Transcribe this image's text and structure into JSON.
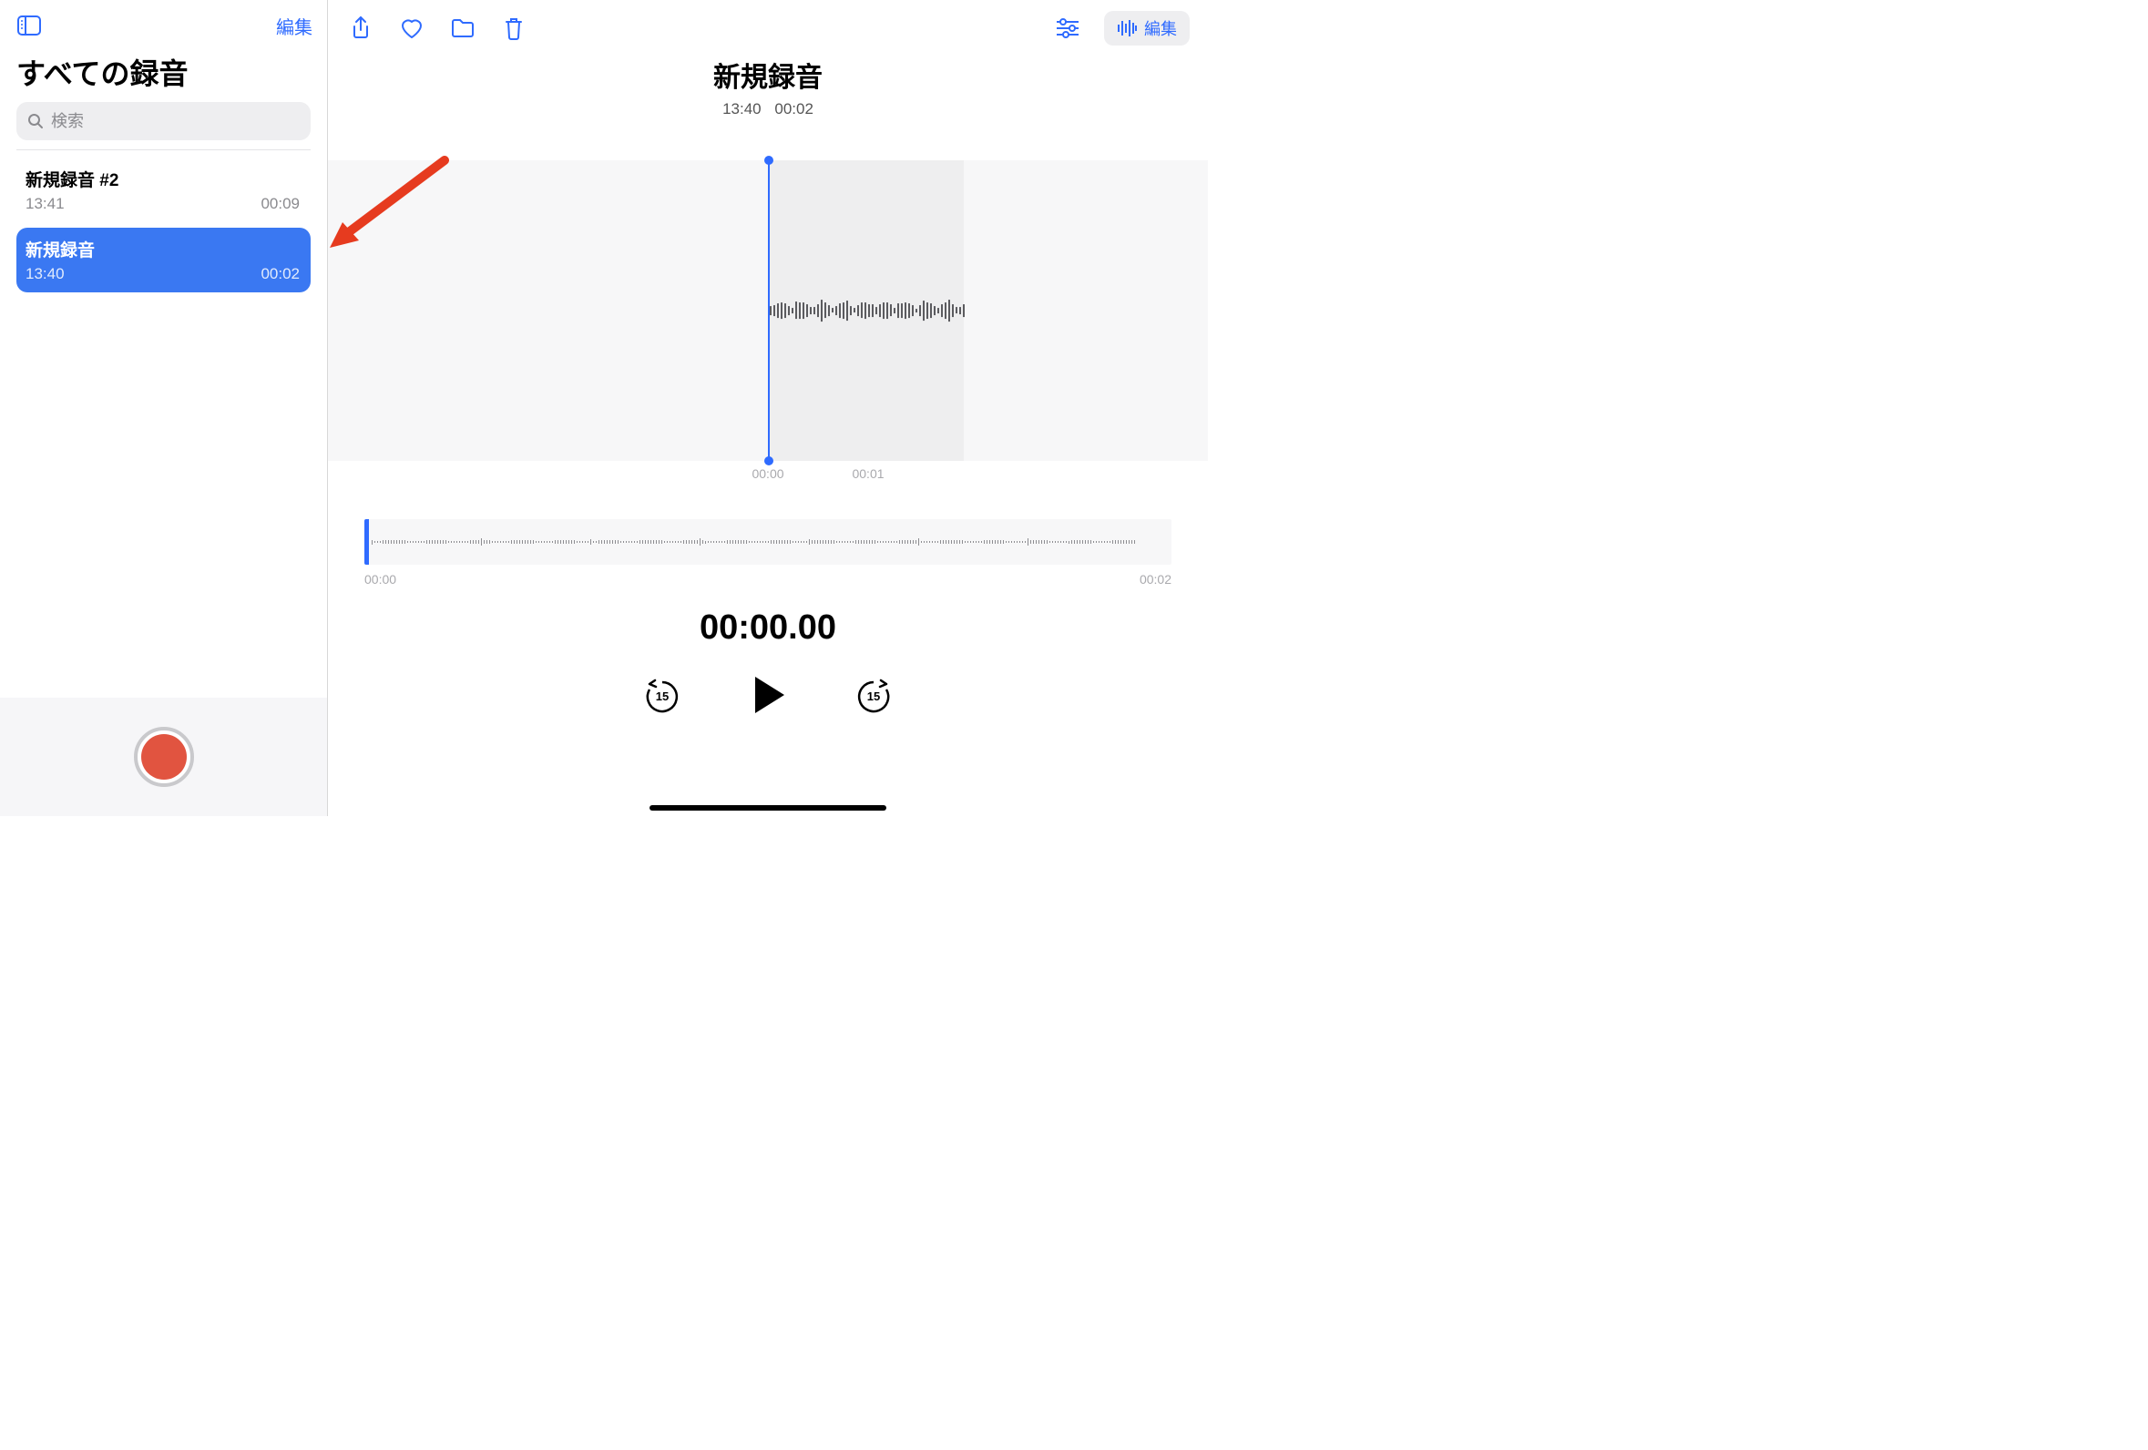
{
  "sidebar": {
    "edit_label": "編集",
    "title": "すべての録音",
    "search_placeholder": "検索"
  },
  "recordings": [
    {
      "title": "新規録音 #2",
      "time": "13:41",
      "duration": "00:09",
      "selected": false
    },
    {
      "title": "新規録音",
      "time": "13:40",
      "duration": "00:02",
      "selected": true
    }
  ],
  "main": {
    "title": "新規録音",
    "recorded_at": "13:40",
    "duration": "00:02",
    "edit_label": "編集"
  },
  "big_wave": {
    "tick_labels": [
      "00:00",
      "00:01"
    ]
  },
  "overview": {
    "start_label": "00:00",
    "end_label": "00:02"
  },
  "playback": {
    "position": "00:00.00",
    "skip_seconds": "15"
  },
  "colors": {
    "accent": "#2f6bff",
    "record": "#e15440"
  }
}
